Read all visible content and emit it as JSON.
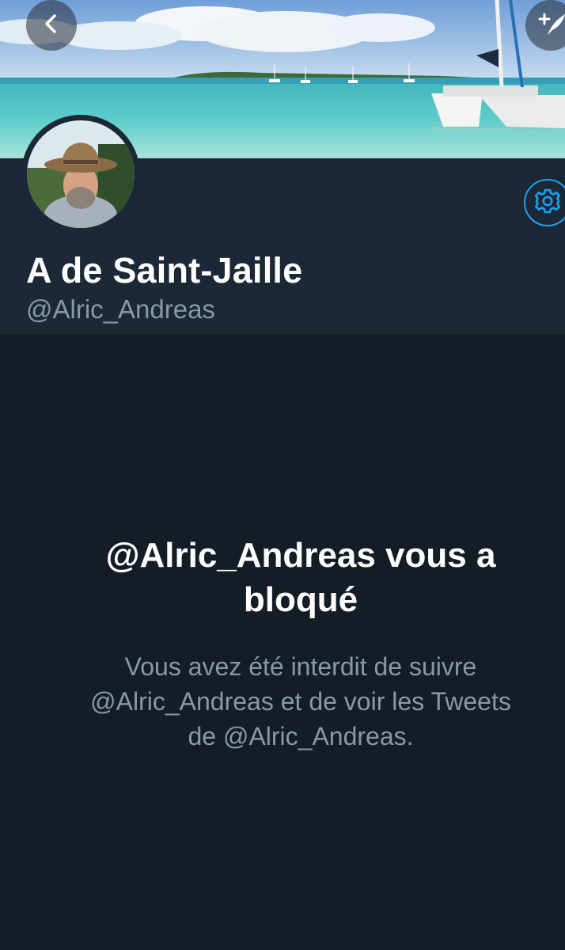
{
  "profile": {
    "display_name": "A de Saint-Jaille",
    "handle": "@Alric_Andreas"
  },
  "blocked": {
    "title": "@Alric_Andreas vous a bloqué",
    "description": "Vous avez été interdit de suivre @Alric_Andreas et de voir les Tweets de @Alric_Andreas."
  },
  "icons": {
    "back": "chevron-left-icon",
    "compose": "compose-tweet-icon",
    "settings": "gear-icon"
  },
  "colors": {
    "background": "#141d26",
    "header_panel": "#1b2836",
    "accent": "#1da1f2",
    "secondary_text": "#8899a6"
  }
}
